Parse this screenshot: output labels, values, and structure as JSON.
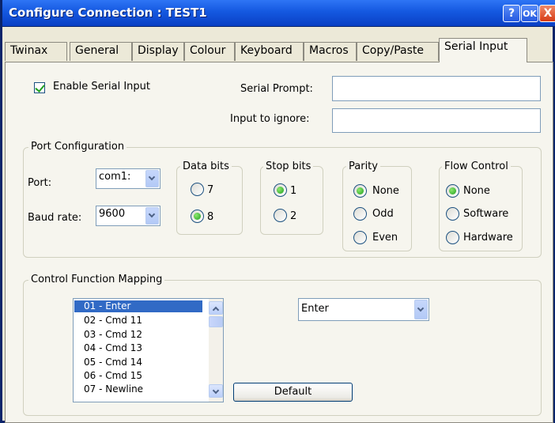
{
  "window": {
    "title": "Configure Connection : TEST1",
    "help_label": "?",
    "ok_label": "OK",
    "close_label": "X"
  },
  "tabs": [
    {
      "label": "Twinax"
    },
    {
      "label": "General"
    },
    {
      "label": "Display"
    },
    {
      "label": "Colour"
    },
    {
      "label": "Keyboard"
    },
    {
      "label": "Macros"
    },
    {
      "label": "Copy/Paste"
    },
    {
      "label": "Serial Input",
      "active": true
    }
  ],
  "serial": {
    "enable_label": "Enable Serial Input",
    "enable_checked": true,
    "prompt_label": "Serial Prompt:",
    "prompt_value": "",
    "ignore_label": "Input to ignore:",
    "ignore_value": ""
  },
  "port_config": {
    "title": "Port Configuration",
    "port_label": "Port:",
    "port_value": "com1:",
    "baud_label": "Baud rate:",
    "baud_value": "9600",
    "data_bits": {
      "title": "Data bits",
      "options": [
        "7",
        "8"
      ],
      "selected": "8"
    },
    "stop_bits": {
      "title": "Stop bits",
      "options": [
        "1",
        "2"
      ],
      "selected": "1"
    },
    "parity": {
      "title": "Parity",
      "options": [
        "None",
        "Odd",
        "Even"
      ],
      "selected": "None"
    },
    "flow_control": {
      "title": "Flow Control",
      "options": [
        "None",
        "Software",
        "Hardware"
      ],
      "selected": "None"
    }
  },
  "mapping": {
    "title": "Control Function Mapping",
    "items": [
      "01 - Enter",
      "02 - Cmd 11",
      "03 - Cmd 12",
      "04 - Cmd 13",
      "05 - Cmd 14",
      "06 - Cmd 15",
      "07 - Newline"
    ],
    "selected": "01 - Enter",
    "function_value": "Enter",
    "default_label": "Default"
  },
  "colors": {
    "accent": "#316AC5",
    "titlebar": "#1458E0",
    "radio_on": "#20A020"
  }
}
